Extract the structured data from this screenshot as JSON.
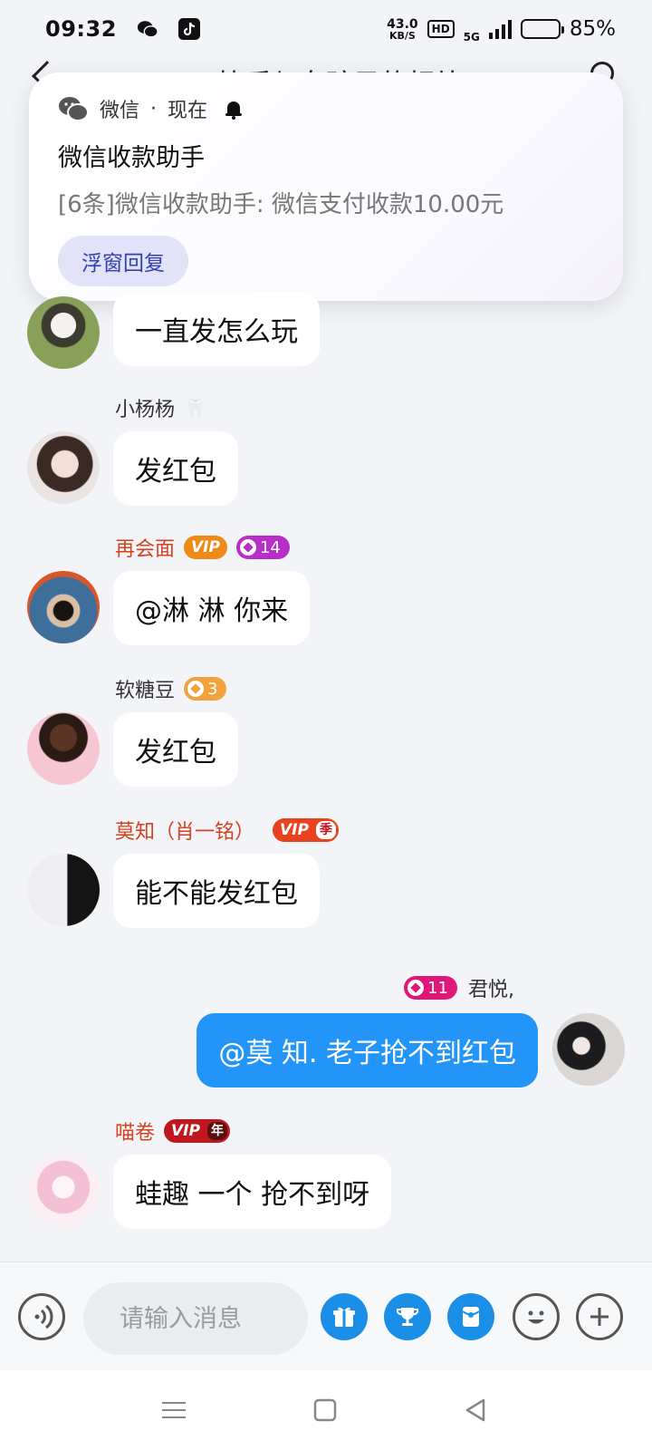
{
  "status_bar": {
    "time": "09:32",
    "net_speed_value": "43.0",
    "net_speed_unit": "KB/S",
    "hd": "HD",
    "network": "5G",
    "battery_pct": "85%",
    "battery_level": 0.85
  },
  "header": {
    "title": "快乐与女孩子的相处",
    "back_icon": "back-arrow-icon",
    "search_icon": "search-icon"
  },
  "notification": {
    "app_name": "微信",
    "time": "现在",
    "title": "微信收款助手",
    "body": "[6条]微信收款助手: 微信支付收款10.00元",
    "reply_button": "浮窗回复"
  },
  "messages": [
    {
      "sender": "",
      "text": "一直发怎么玩",
      "self": false
    },
    {
      "sender": "小杨杨",
      "sender_emoji": "🦷",
      "text": "发红包",
      "self": false
    },
    {
      "sender": "再会面",
      "vip": "VIP",
      "level": "14",
      "text": "@淋  淋 你来",
      "self": false
    },
    {
      "sender": "软糖豆",
      "level": "3",
      "text": "发红包",
      "self": false
    },
    {
      "sender": "莫知（肖一铭）",
      "vip": "VIP",
      "vip_suffix": "季",
      "text": "能不能发红包",
      "self": false
    },
    {
      "sender": "君悦,",
      "level": "11",
      "text": "@莫 知. 老子抢不到红包",
      "self": true
    },
    {
      "sender": "喵卷",
      "vip": "VIP",
      "vip_suffix": "年",
      "text": "蛙趣  一个 抢不到呀",
      "self": false
    }
  ],
  "input_bar": {
    "placeholder": "请输入消息",
    "buttons": [
      "voice-icon",
      "gift-icon",
      "trophy-icon",
      "red-packet-icon",
      "emoji-icon",
      "plus-icon"
    ]
  },
  "colors": {
    "accent_blue": "#2395f8",
    "vip_orange": "#f08a17",
    "vip_red": "#d43a2a",
    "level_magenta": "#b72fc8",
    "level_orange": "#f2a23a",
    "level_pink": "#e0177a"
  }
}
